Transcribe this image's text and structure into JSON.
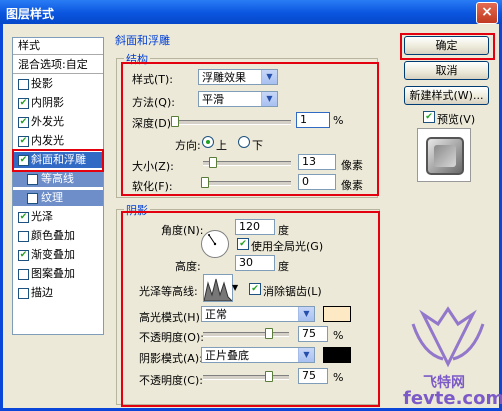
{
  "window": {
    "title": "图层样式",
    "close_glyph": "×"
  },
  "left_list": {
    "header": "样式",
    "blend": "混合选项:自定",
    "items": [
      {
        "label": "投影",
        "checked": false
      },
      {
        "label": "内阴影",
        "checked": true
      },
      {
        "label": "外发光",
        "checked": true
      },
      {
        "label": "内发光",
        "checked": true
      },
      {
        "label": "斜面和浮雕",
        "checked": true,
        "selected": true
      },
      {
        "label": "等高线",
        "checked": false,
        "sub": true
      },
      {
        "label": "纹理",
        "checked": false,
        "sub": true
      },
      {
        "label": "光泽",
        "checked": true
      },
      {
        "label": "颜色叠加",
        "checked": false
      },
      {
        "label": "渐变叠加",
        "checked": true
      },
      {
        "label": "图案叠加",
        "checked": false
      },
      {
        "label": "描边",
        "checked": false
      }
    ],
    "check_glyph": "✔"
  },
  "bevel": {
    "section_title": "斜面和浮雕",
    "structure": {
      "title": "结构",
      "style_label": "样式(T):",
      "style_value": "浮雕效果",
      "method_label": "方法(Q):",
      "method_value": "平滑",
      "depth_label": "深度(D):",
      "depth_value": "1",
      "depth_unit": "%",
      "direction_label": "方向:",
      "dir_up": "上",
      "dir_down": "下",
      "size_label": "大小(Z):",
      "size_value": "13",
      "size_unit": "像素",
      "soften_label": "软化(F):",
      "soften_value": "0",
      "soften_unit": "像素"
    },
    "shading": {
      "title": "阴影",
      "angle_label": "角度(N):",
      "angle_value": "120",
      "angle_unit": "度",
      "global_light_label": "使用全局光(G)",
      "altitude_label": "高度:",
      "altitude_value": "30",
      "altitude_unit": "度",
      "gloss_label": "光泽等高线:",
      "antialias_label": "消除锯齿(L)",
      "highlight_mode_label": "高光模式(H):",
      "highlight_mode_value": "正常",
      "highlight_color": "#fde9c4",
      "highlight_opacity_label": "不透明度(O):",
      "highlight_opacity_value": "75",
      "highlight_opacity_unit": "%",
      "shadow_mode_label": "阴影模式(A):",
      "shadow_mode_value": "正片叠底",
      "shadow_color": "#000000",
      "shadow_opacity_label": "不透明度(C):",
      "shadow_opacity_value": "75",
      "shadow_opacity_unit": "%"
    }
  },
  "buttons": {
    "ok": "确定",
    "cancel": "取消",
    "new_style": "新建样式(W)...",
    "preview": "预览(V)"
  },
  "dropdown_glyph": "▼",
  "watermark": {
    "text1": "飞特网",
    "text2": "fevte.com"
  },
  "colors": {
    "accent": "#316ac5",
    "highlight_red": "#e3000f"
  }
}
